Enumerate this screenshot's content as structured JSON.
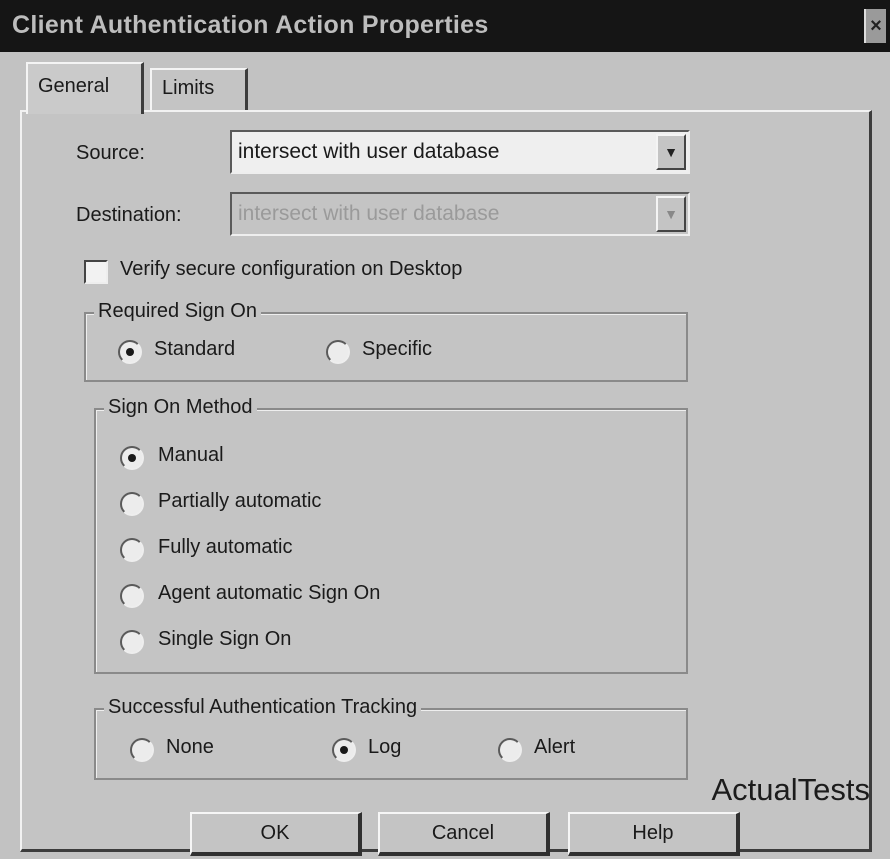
{
  "window": {
    "title": "Client Authentication Action Properties",
    "close_glyph": "×"
  },
  "tabs": [
    {
      "label": "General",
      "active": true
    },
    {
      "label": "Limits",
      "active": false
    }
  ],
  "general": {
    "source_label": "Source:",
    "source_value": "intersect with user database",
    "destination_label": "Destination:",
    "destination_value": "intersect with user database",
    "destination_disabled": true,
    "verify_label": "Verify secure configuration on Desktop",
    "verify_checked": false,
    "required_sign_on": {
      "title": "Required Sign On",
      "options": [
        {
          "label": "Standard",
          "checked": true
        },
        {
          "label": "Specific",
          "checked": false
        }
      ]
    },
    "sign_on_method": {
      "title": "Sign On Method",
      "options": [
        {
          "label": "Manual",
          "checked": true
        },
        {
          "label": "Partially automatic",
          "checked": false
        },
        {
          "label": "Fully automatic",
          "checked": false
        },
        {
          "label": "Agent automatic Sign On",
          "checked": false
        },
        {
          "label": "Single Sign On",
          "checked": false
        }
      ]
    },
    "tracking": {
      "title": "Successful Authentication Tracking",
      "options": [
        {
          "label": "None",
          "checked": false
        },
        {
          "label": "Log",
          "checked": true
        },
        {
          "label": "Alert",
          "checked": false
        }
      ]
    }
  },
  "buttons": {
    "ok": "OK",
    "cancel": "Cancel",
    "help": "Help"
  },
  "watermark": "ActualTests",
  "icons": {
    "dropdown": "chevron-down-icon",
    "close": "close-icon"
  }
}
